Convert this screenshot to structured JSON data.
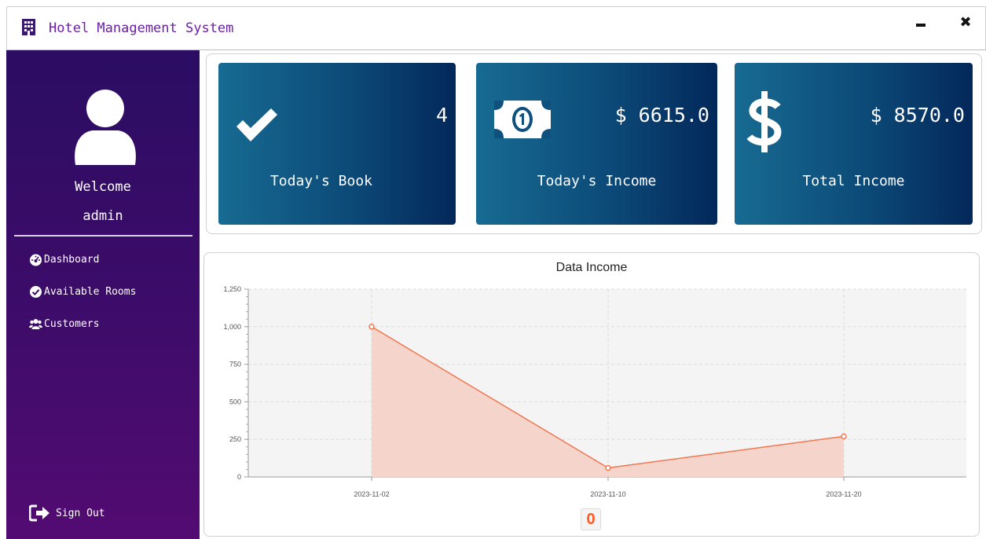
{
  "window": {
    "title": "Hotel Management System",
    "minimize_icon": "minimize-icon",
    "close_icon": "close-icon",
    "close_glyph": "✖"
  },
  "sidebar": {
    "welcome": "Welcome",
    "username": "admin",
    "items": [
      {
        "label": "Dashboard",
        "icon": "dashboard-gauge-icon"
      },
      {
        "label": "Available Rooms",
        "icon": "check-circle-icon"
      },
      {
        "label": "Customers",
        "icon": "users-icon"
      }
    ],
    "signout": {
      "label": "Sign Out",
      "icon": "sign-out-icon"
    }
  },
  "cards": [
    {
      "value": "4",
      "label": "Today's Book",
      "icon": "check-icon"
    },
    {
      "value": "$ 6615.0",
      "label": "Today's Income",
      "icon": "money-bill-icon"
    },
    {
      "value": "$ 8570.0",
      "label": "Total Income",
      "icon": "dollar-icon"
    }
  ],
  "chart_data": {
    "type": "area",
    "title": "Data Income",
    "x": [
      "2023-11-02",
      "2023-11-10",
      "2023-11-20"
    ],
    "series": [
      {
        "values": [
          1000,
          60,
          270
        ]
      }
    ],
    "ylim": [
      0,
      1250
    ],
    "yticks": [
      "0",
      "250",
      "500",
      "750",
      "1,000",
      "1,250"
    ],
    "grid": true,
    "line_color": "#f07850",
    "fill_color": "#f5d5cb"
  },
  "footer_badge": "0",
  "colors": {
    "accent": "#6a1fa8",
    "sidebar": "#3e0c6a",
    "card": "#0c4a78"
  }
}
